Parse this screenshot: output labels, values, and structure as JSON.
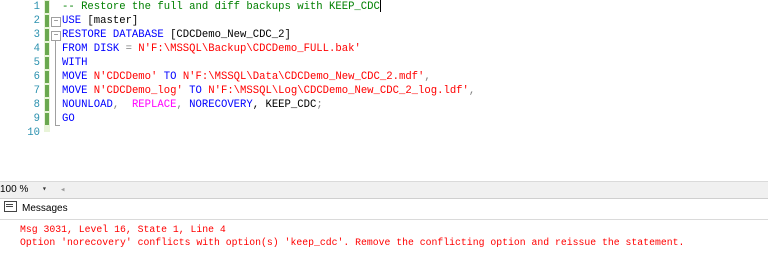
{
  "editor": {
    "lines": [
      {
        "no": "1",
        "segs": [
          {
            "t": "-- Restore the full and diff backups with KEEP_CDC",
            "c": "cm"
          }
        ],
        "cursor": true
      },
      {
        "no": "2",
        "segs": [
          {
            "t": "USE",
            "c": "kw"
          },
          {
            "t": " [master]",
            "c": "pl"
          }
        ]
      },
      {
        "no": "3",
        "segs": [
          {
            "t": "RESTORE DATABASE",
            "c": "kw"
          },
          {
            "t": " [CDCDemo_New_CDC_2]",
            "c": "pl"
          }
        ]
      },
      {
        "no": "4",
        "segs": [
          {
            "t": "FROM DISK",
            "c": "kw"
          },
          {
            "t": " = ",
            "c": "gray"
          },
          {
            "t": "N'F:\\MSSQL\\Backup\\CDCDemo_FULL.bak'",
            "c": "str"
          }
        ]
      },
      {
        "no": "5",
        "segs": [
          {
            "t": "WITH",
            "c": "kw"
          }
        ]
      },
      {
        "no": "6",
        "segs": [
          {
            "t": "MOVE",
            "c": "kw"
          },
          {
            "t": " ",
            "c": "pl"
          },
          {
            "t": "N'CDCDemo'",
            "c": "str"
          },
          {
            "t": " TO ",
            "c": "kw"
          },
          {
            "t": "N'F:\\MSSQL\\Data\\CDCDemo_New_CDC_2.mdf'",
            "c": "str"
          },
          {
            "t": ",",
            "c": "gray"
          }
        ]
      },
      {
        "no": "7",
        "segs": [
          {
            "t": "MOVE",
            "c": "kw"
          },
          {
            "t": " ",
            "c": "pl"
          },
          {
            "t": "N'CDCDemo_log'",
            "c": "str"
          },
          {
            "t": " TO ",
            "c": "kw"
          },
          {
            "t": "N'F:\\MSSQL\\Log\\CDCDemo_New_CDC_2_log.ldf'",
            "c": "str"
          },
          {
            "t": ",",
            "c": "gray"
          }
        ]
      },
      {
        "no": "8",
        "segs": [
          {
            "t": "NOUNLOAD",
            "c": "kw"
          },
          {
            "t": ",  ",
            "c": "gray"
          },
          {
            "t": "REPLACE",
            "c": "pink"
          },
          {
            "t": ", ",
            "c": "gray"
          },
          {
            "t": "NORECOVERY",
            "c": "kw"
          },
          {
            "t": ", KEEP_CDC",
            "c": "pl"
          },
          {
            "t": ";",
            "c": "gray"
          }
        ]
      },
      {
        "no": "9",
        "segs": [
          {
            "t": "GO",
            "c": "kw"
          }
        ]
      },
      {
        "no": "10",
        "segs": []
      }
    ]
  },
  "status": {
    "zoom": "100 %",
    "zoom_arrow": "▾",
    "scroll_left": "◂"
  },
  "results": {
    "tab_label": "Messages",
    "messages": [
      "Msg 3031, Level 16, State 1, Line 4",
      "Option 'norecovery' conflicts with option(s) 'keep_cdc'. Remove the conflicting option and reissue the statement."
    ]
  }
}
